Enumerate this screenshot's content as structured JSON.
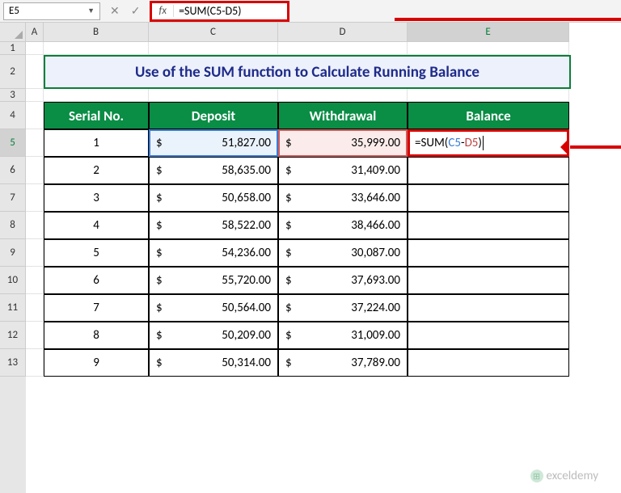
{
  "namebox": "E5",
  "formula": "=SUM(C5-D5)",
  "edit_formula": {
    "prefix": "=SUM(",
    "ref1": "C5",
    "op": "-",
    "ref2": "D5",
    "suffix": ")"
  },
  "fx_label": "fx",
  "col_headers": [
    "A",
    "B",
    "C",
    "D",
    "E"
  ],
  "row_headers": [
    "1",
    "2",
    "3",
    "4",
    "5",
    "6",
    "7",
    "8",
    "9",
    "10",
    "11",
    "12",
    "13"
  ],
  "title": "Use of the SUM function to Calculate Running Balance",
  "table_headers": {
    "serial": "Serial No.",
    "deposit": "Deposit",
    "withdrawal": "Withdrawal",
    "balance": "Balance"
  },
  "rows": [
    {
      "n": "1",
      "dep": "51,827.00",
      "wd": "35,999.00"
    },
    {
      "n": "2",
      "dep": "58,635.00",
      "wd": "31,409.00"
    },
    {
      "n": "3",
      "dep": "50,658.00",
      "wd": "33,646.00"
    },
    {
      "n": "4",
      "dep": "58,522.00",
      "wd": "38,466.00"
    },
    {
      "n": "5",
      "dep": "54,236.00",
      "wd": "30,087.00"
    },
    {
      "n": "6",
      "dep": "55,720.00",
      "wd": "37,693.00"
    },
    {
      "n": "7",
      "dep": "50,564.00",
      "wd": "37,224.00"
    },
    {
      "n": "8",
      "dep": "50,209.00",
      "wd": "31,009.00"
    },
    {
      "n": "9",
      "dep": "50,314.00",
      "wd": "37,789.00"
    }
  ],
  "currency": "$",
  "watermark": "exceldemy"
}
